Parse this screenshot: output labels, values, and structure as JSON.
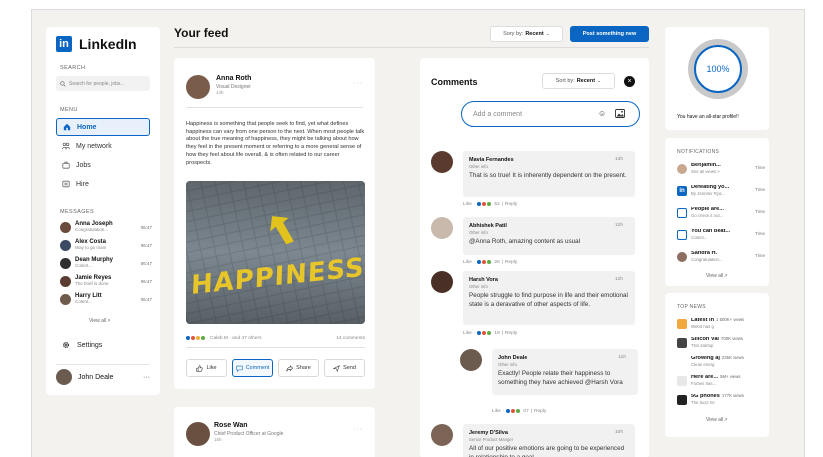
{
  "app": {
    "name": "LinkedIn",
    "logo_letters": "in"
  },
  "sidebar": {
    "search_label": "SEARCH",
    "search_placeholder": "Search for people, jobs...",
    "menu_label": "MENU",
    "menu": [
      {
        "label": "Home",
        "icon": "home-icon",
        "active": true
      },
      {
        "label": "My network",
        "icon": "network-icon"
      },
      {
        "label": "Jobs",
        "icon": "briefcase-icon"
      },
      {
        "label": "Hire",
        "icon": "id-card-icon"
      }
    ],
    "messages_label": "MESSAGES",
    "messages": [
      {
        "name": "Anna Joseph",
        "preview": "Congratulation...",
        "time": "06:47"
      },
      {
        "name": "Alex Costa",
        "preview": "Way to go man!",
        "time": "06:47"
      },
      {
        "name": "Dean Murphy",
        "preview": "Cotent...",
        "time": "06:47"
      },
      {
        "name": "Jamie Reyes",
        "preview": "The brief is done",
        "time": "06:47"
      },
      {
        "name": "Harry Litt",
        "preview": "Cotent...",
        "time": "06:47"
      }
    ],
    "view_all": "View all >",
    "settings": "Settings",
    "user": {
      "name": "John Deale",
      "more": "···"
    }
  },
  "feed": {
    "title": "Your feed",
    "sort_prefix": "Sory by:",
    "sort_value": "Recent",
    "post_button": "Post something new",
    "posts": [
      {
        "author": "Anna Roth",
        "role": "Visual Designer",
        "time": "14h",
        "body": "Happiness is something that people seek to find, yet what defines happiness can vary from one person to the next. When most people talk about the true meaning of happiness, they might be talking about how they feel in the present moment or referring to a more general sense of how they feel about life overall, & is often related to our career prospects.",
        "image_text": "HAPPINESS",
        "reactions_text": "Caleb M - and 47 others",
        "comments_count": "14 comments",
        "actions": [
          "Like",
          "Comment",
          "Share",
          "Send"
        ]
      },
      {
        "author": "Rose Wan",
        "role": "Chief Product Officer at Google",
        "time": "15h"
      }
    ]
  },
  "comments": {
    "title": "Comments",
    "sort_prefix": "Sort by:",
    "sort_value": "Recent",
    "input_placeholder": "Add a comment",
    "items": [
      {
        "name": "Mavia Fernandes",
        "title": "Other info",
        "time": "13h",
        "text": "That is so true! It is inherently dependent on the present.",
        "likes": "52",
        "reply": "Reply"
      },
      {
        "name": "Abhishek Patil",
        "title": "Other info",
        "time": "12h",
        "text": "@Anna Roth, amazing content as usual",
        "likes": "26",
        "reply": "Reply"
      },
      {
        "name": "Harsh Vora",
        "title": "Other info",
        "time": "12h",
        "text": "People struggle to find purpose in life and their emotional state is a deravative of other aspects of life.",
        "likes": "18",
        "reply": "Reply"
      },
      {
        "name": "John Deale",
        "title": "Other info",
        "time": "11h",
        "text": "Exactly! People relate their happiness to something they have achieved @Harsh Vora",
        "likes": "07",
        "reply": "Reply"
      },
      {
        "name": "Jeremy D'Silva",
        "title": "Senior Product Manger",
        "time": "10h",
        "text": "All of our positive emotions are going to be experienced in relationship to a goal."
      }
    ],
    "like_label": "Like"
  },
  "profile": {
    "percent": "100%",
    "caption": "You have an all-star profile!!"
  },
  "notifications": {
    "label": "NOTIFICATIONS",
    "items": [
      {
        "title": "Benjamin...",
        "sub": "See all views >",
        "time": "Time"
      },
      {
        "title": "Defeating yo...",
        "sub": "By Jennifer Rya...",
        "time": "Time"
      },
      {
        "title": "People are...",
        "sub": "Go check it out...",
        "time": "Time"
      },
      {
        "title": "You can beat...",
        "sub": "Cotent...",
        "time": "Time"
      },
      {
        "title": "Sandra H.",
        "sub": "Congratulation...",
        "time": "Time"
      }
    ],
    "view_all": "View all >"
  },
  "news": {
    "label": "TOP NEWS",
    "items": [
      {
        "title": "Latest in",
        "views": "1 500K+ views",
        "sub": "Web3 has g"
      },
      {
        "title": "Silicon Val",
        "views": "700K views",
        "sub": "This startup"
      },
      {
        "title": "Growing aj",
        "views": "235K views",
        "sub": "Clean energ"
      },
      {
        "title": "Here are...",
        "views": "5M+ views",
        "sub": "Forbes has..."
      },
      {
        "title": "5G phones",
        "views": "177K views",
        "sub": "The buzz for"
      }
    ],
    "view_all": "View all >"
  },
  "colors": {
    "accent": "#0a66c2",
    "background": "#f3f2ee"
  }
}
